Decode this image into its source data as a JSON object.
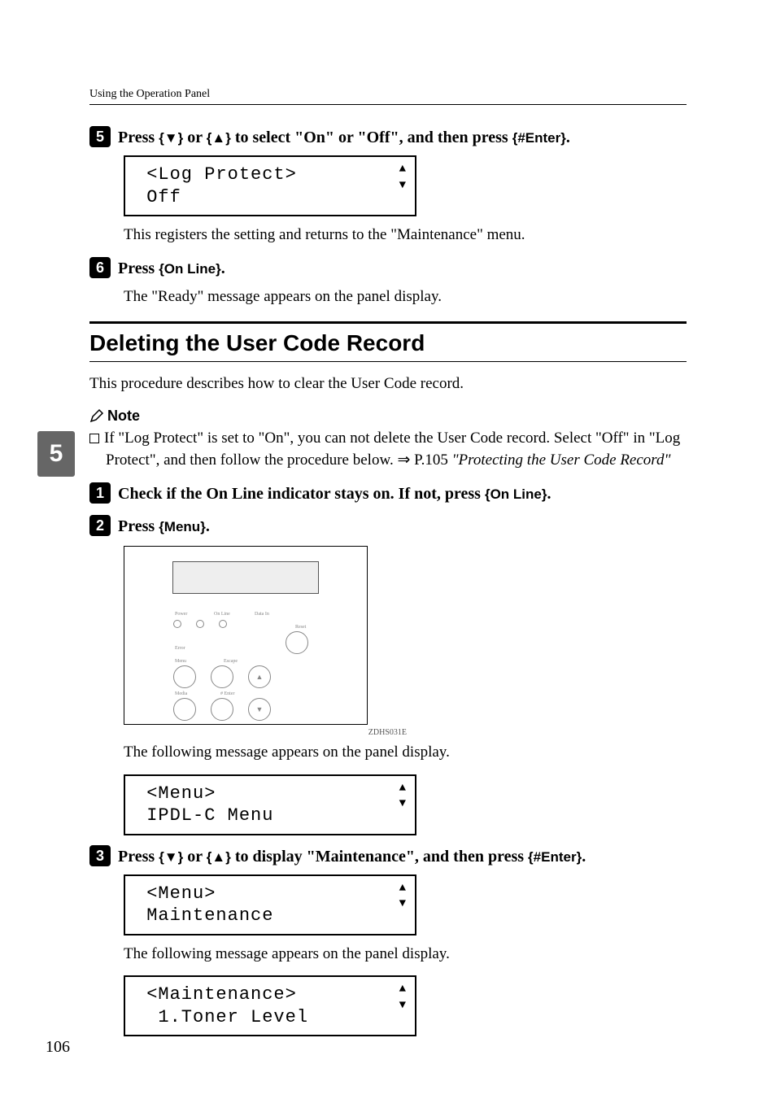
{
  "running_header": "Using the Operation Panel",
  "side_tab": "5",
  "page_number": "106",
  "step5": {
    "num": "5",
    "text_pre": "Press ",
    "key1": "{T}",
    "text_mid1": " or ",
    "key2": "{U}",
    "text_mid2": " to select \"On\" or \"Off\", and then press ",
    "key3": "{#Enter}",
    "text_post": ".",
    "lcd_line1": " <Log Protect>",
    "lcd_line2": " Off",
    "body": "This registers the setting and returns to the \"Maintenance\" menu."
  },
  "step6": {
    "num": "6",
    "text_pre": "Press ",
    "key1": "{On Line}",
    "text_post": ".",
    "body": "The \"Ready\" message appears on the panel display."
  },
  "section_heading": "Deleting the User Code Record",
  "section_intro": "This procedure describes how to clear the User Code record.",
  "note_label": "Note",
  "note_body_pre": "If \"Log Protect\" is set to \"On\", you can not delete the User Code record. Select \"Off\" in \"Log Protect\", and then follow the procedure below. ⇒ P.105 ",
  "note_body_italic": "\"Protecting the User Code Record\"",
  "stepA": {
    "num": "1",
    "text_pre": "Check if the On Line indicator stays on. If not, press ",
    "key1": "{On Line}",
    "text_post": "."
  },
  "stepB": {
    "num": "2",
    "text_pre": "Press ",
    "key1": "{Menu}",
    "text_post": "."
  },
  "panel_labels": {
    "power": "Power",
    "online": "On Line",
    "datain": "Data In",
    "reset": "Reset",
    "error": "Error",
    "menu": "Menu",
    "escape": "Escape",
    "media": "Media",
    "enter": "# Enter"
  },
  "illus_code": "ZDHS031E",
  "stepB_body": "The following message appears on the panel display.",
  "lcd_menu1_line1": " <Menu>",
  "lcd_menu1_line2": " IPDL-C Menu",
  "stepC": {
    "num": "3",
    "text_pre": "Press ",
    "key1": "{T}",
    "text_mid1": " or ",
    "key2": "{U}",
    "text_mid2": " to display \"Maintenance\", and then press ",
    "key3": "{#Enter}",
    "text_post": "."
  },
  "lcd_menu2_line1": " <Menu>",
  "lcd_menu2_line2": " Maintenance",
  "stepC_body": "The following message appears on the panel display.",
  "lcd_maint_line1": " <Maintenance>",
  "lcd_maint_line2": "  1.Toner Level"
}
